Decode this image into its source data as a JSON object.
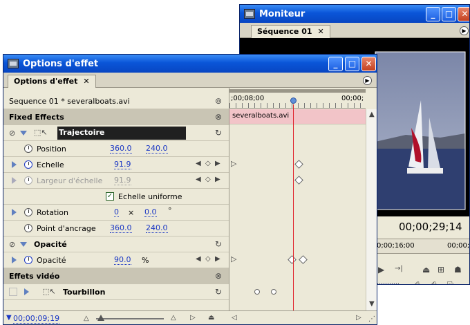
{
  "moniteur": {
    "title": "Moniteur",
    "tab": "Séquence 01",
    "timecode": "00;00;29;14",
    "ruler_left": "0;00;16;00",
    "ruler_right": "00;00;"
  },
  "effect": {
    "title": "Options d'effet",
    "tab": "Options d'effet",
    "sequence_label": "Sequence 01 * severalboats.avi",
    "ruler_start": ";00;08;00",
    "ruler_end": "00;00;",
    "clip_name": "severalboats.avi",
    "fixed_effects": "Fixed Effects",
    "trajectoire": "Trajectoire",
    "position_label": "Position",
    "position_x": "360.0",
    "position_y": "240.0",
    "echelle_label": "Echelle",
    "echelle_value": "91.9",
    "largeur_label": "Largeur d'échelle",
    "largeur_value": "91.9",
    "uniform_label": "Echelle uniforme",
    "rotation_label": "Rotation",
    "rotation_a": "0",
    "rotation_x": "×",
    "rotation_b": "0.0",
    "rotation_deg": "°",
    "ancrage_label": "Point d'ancrage",
    "ancrage_x": "360.0",
    "ancrage_y": "240.0",
    "opacite_group": "Opacité",
    "opacite_label": "Opacité",
    "opacite_value": "90.0",
    "opacite_unit": "%",
    "video_effects": "Effets vidéo",
    "tourbillon": "Tourbillon",
    "current_time": "00;00;09;19"
  },
  "colors": {
    "titlebar": "#0a55d8",
    "clip_bar": "#f2c4c8",
    "playhead": "#e0202a",
    "value_blue": "#1a37c4"
  }
}
